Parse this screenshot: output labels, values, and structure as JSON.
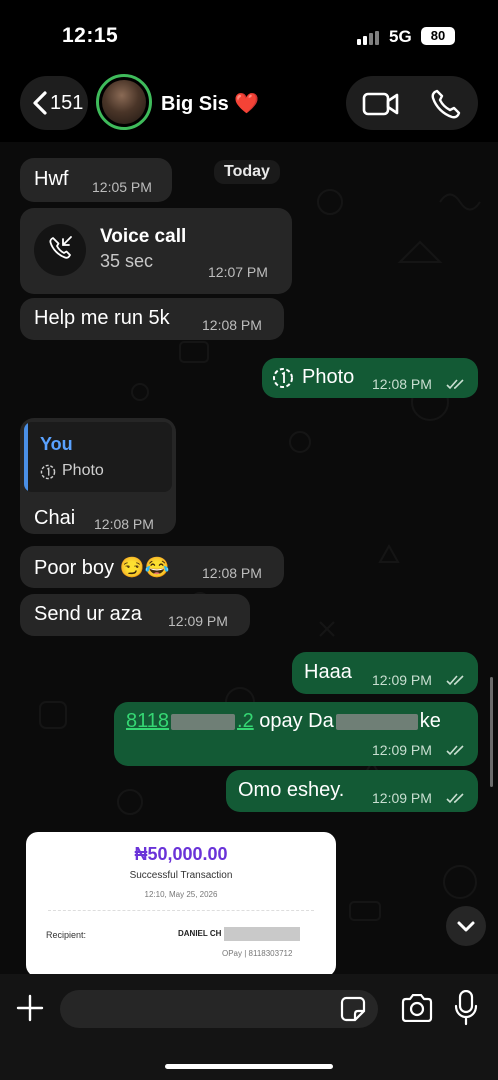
{
  "status_bar": {
    "time": "12:15",
    "network": "5G",
    "battery": "80"
  },
  "header": {
    "back_count": "151",
    "contact_name": "Big Sis ❤️"
  },
  "chat": {
    "date_chip": "Today",
    "messages": [
      {
        "text": "Hwf",
        "time": "12:05 PM"
      },
      {
        "title": "Voice call",
        "duration": "35 sec",
        "time": "12:07 PM"
      },
      {
        "text": "Help me run 5k",
        "time": "12:08 PM"
      },
      {
        "text": "Photo",
        "time": "12:08 PM"
      },
      {
        "reply_name": "You",
        "reply_preview": "Photo",
        "text": "Chai",
        "time": "12:08 PM"
      },
      {
        "text": "Poor boy 😏😂",
        "time": "12:08 PM"
      },
      {
        "text": "Send ur aza",
        "time": "12:09 PM"
      },
      {
        "text": "Haaa",
        "time": "12:09 PM"
      },
      {
        "link_start": "8118",
        "link_end": ".2",
        "text_mid": " opay Da",
        "text_end": "ke",
        "time": "12:09 PM"
      },
      {
        "text": "Omo eshey.",
        "time": "12:09 PM"
      }
    ],
    "receipt": {
      "amount": "₦50,000.00",
      "status": "Successful Transaction",
      "date": "12:10, May 25, 2026",
      "recipient_label": "Recipient:",
      "recipient_name": "DANIEL CH",
      "recipient_sub": "OPay | 8118303712"
    }
  },
  "input": {
    "placeholder": ""
  },
  "colors": {
    "incoming_bubble": "#262626",
    "outgoing_bubble": "#135a35",
    "avatar_ring": "#3fbb5b",
    "link": "#35d673",
    "reply_accent": "#5aa2ff"
  }
}
